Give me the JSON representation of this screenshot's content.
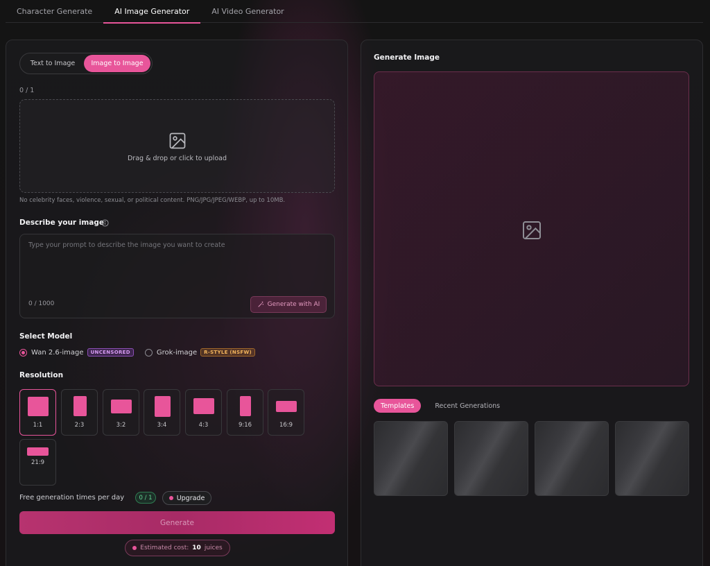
{
  "top_tabs": [
    {
      "label": "Character Generate",
      "active": false
    },
    {
      "label": "AI Image Generator",
      "active": true
    },
    {
      "label": "AI Video Generator",
      "active": false
    }
  ],
  "mode_toggle": {
    "text_to_image": "Text to Image",
    "image_to_image": "Image to Image",
    "selected": "image_to_image"
  },
  "upload": {
    "count": "0 / 1",
    "text": "Drag & drop or click to upload",
    "icon": "image-icon",
    "hint": "No celebrity faces, violence, sexual, or political content. PNG/JPG/JPEG/WEBP, up to 10MB."
  },
  "prompt": {
    "label": "Describe your image",
    "placeholder": "Type your prompt to describe the image you want to create",
    "value": "",
    "char_count": "0 / 1000",
    "generate_ai_label": "Generate with AI"
  },
  "model": {
    "label": "Select Model",
    "options": [
      {
        "name": "Wan 2.6-image",
        "tag": "UNCENSORED",
        "selected": true
      },
      {
        "name": "Grok-image",
        "tag": "R-STYLE (NSFW)",
        "selected": false
      }
    ]
  },
  "resolution": {
    "label": "Resolution",
    "options": [
      "1:1",
      "2:3",
      "3:2",
      "3:4",
      "4:3",
      "9:16",
      "16:9",
      "21:9"
    ],
    "selected": "1:1"
  },
  "free_generation": {
    "label": "Free generation times per day",
    "count": "0 / 1",
    "upgrade_label": "Upgrade"
  },
  "generate_label": "Generate",
  "cost": {
    "prefix": "Estimated cost:",
    "amount": "10",
    "unit": "juices"
  },
  "preview": {
    "title": "Generate Image",
    "icon": "image-icon"
  },
  "gallery_tabs": [
    {
      "label": "Templates",
      "active": true
    },
    {
      "label": "Recent Generations",
      "active": false
    }
  ],
  "colors": {
    "accent": "#e8559a",
    "success": "#63d393",
    "background": "#141414"
  }
}
